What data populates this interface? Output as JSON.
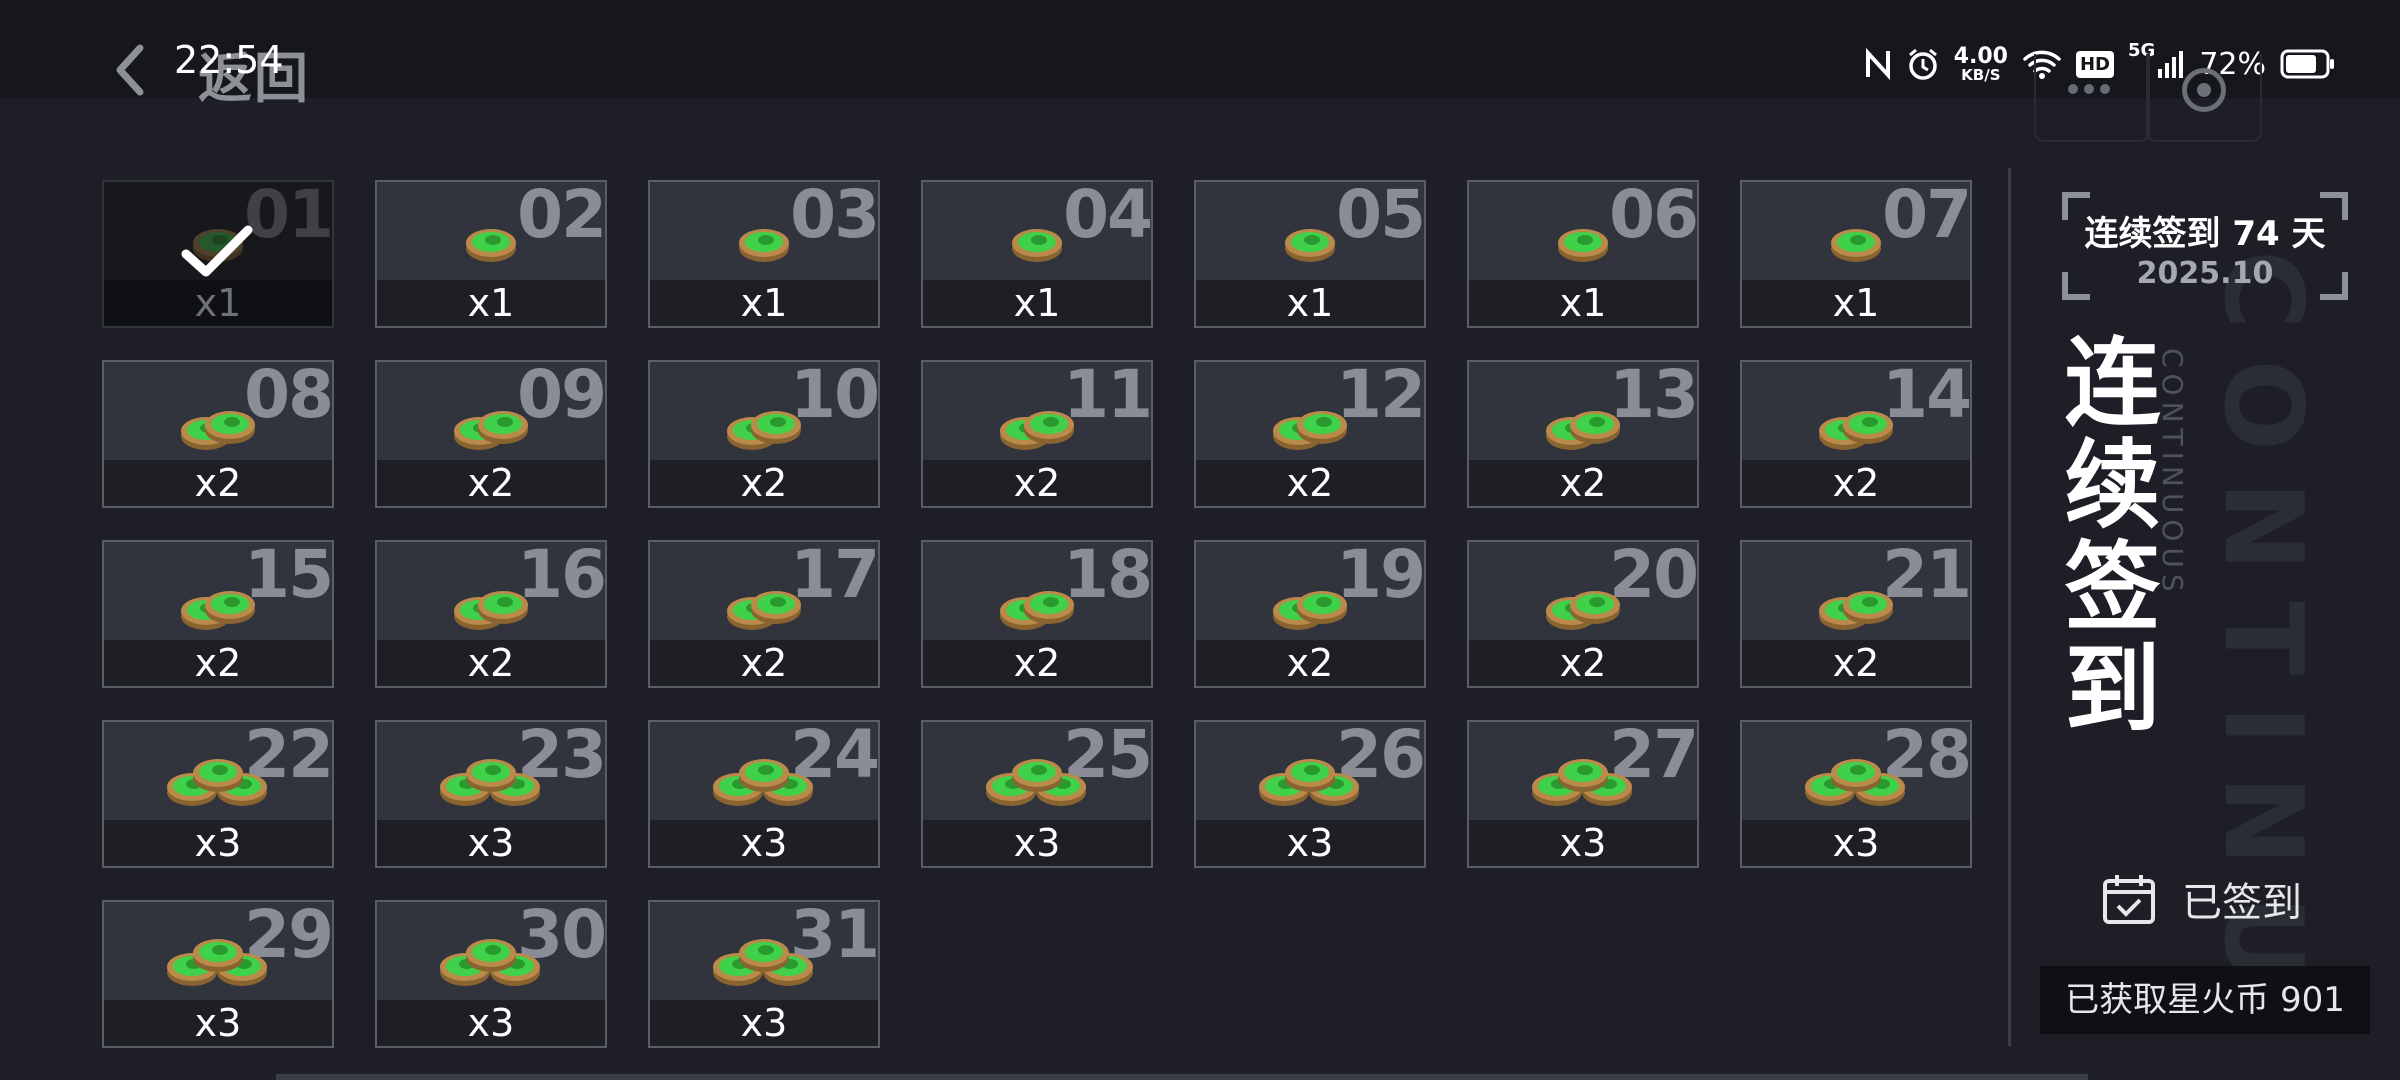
{
  "header": {
    "back_label": "返回",
    "time": "22:54",
    "net_speed_value": "4.00",
    "net_speed_unit": "KB/S",
    "hd_badge": "HD",
    "network_type": "5G",
    "battery_percent": "72%"
  },
  "days": [
    {
      "day": "01",
      "qty": "x1",
      "coins": 1,
      "claimed": true
    },
    {
      "day": "02",
      "qty": "x1",
      "coins": 1,
      "claimed": false
    },
    {
      "day": "03",
      "qty": "x1",
      "coins": 1,
      "claimed": false
    },
    {
      "day": "04",
      "qty": "x1",
      "coins": 1,
      "claimed": false
    },
    {
      "day": "05",
      "qty": "x1",
      "coins": 1,
      "claimed": false
    },
    {
      "day": "06",
      "qty": "x1",
      "coins": 1,
      "claimed": false
    },
    {
      "day": "07",
      "qty": "x1",
      "coins": 1,
      "claimed": false
    },
    {
      "day": "08",
      "qty": "x2",
      "coins": 2,
      "claimed": false
    },
    {
      "day": "09",
      "qty": "x2",
      "coins": 2,
      "claimed": false
    },
    {
      "day": "10",
      "qty": "x2",
      "coins": 2,
      "claimed": false
    },
    {
      "day": "11",
      "qty": "x2",
      "coins": 2,
      "claimed": false
    },
    {
      "day": "12",
      "qty": "x2",
      "coins": 2,
      "claimed": false
    },
    {
      "day": "13",
      "qty": "x2",
      "coins": 2,
      "claimed": false
    },
    {
      "day": "14",
      "qty": "x2",
      "coins": 2,
      "claimed": false
    },
    {
      "day": "15",
      "qty": "x2",
      "coins": 2,
      "claimed": false
    },
    {
      "day": "16",
      "qty": "x2",
      "coins": 2,
      "claimed": false
    },
    {
      "day": "17",
      "qty": "x2",
      "coins": 2,
      "claimed": false
    },
    {
      "day": "18",
      "qty": "x2",
      "coins": 2,
      "claimed": false
    },
    {
      "day": "19",
      "qty": "x2",
      "coins": 2,
      "claimed": false
    },
    {
      "day": "20",
      "qty": "x2",
      "coins": 2,
      "claimed": false
    },
    {
      "day": "21",
      "qty": "x2",
      "coins": 2,
      "claimed": false
    },
    {
      "day": "22",
      "qty": "x3",
      "coins": 3,
      "claimed": false
    },
    {
      "day": "23",
      "qty": "x3",
      "coins": 3,
      "claimed": false
    },
    {
      "day": "24",
      "qty": "x3",
      "coins": 3,
      "claimed": false
    },
    {
      "day": "25",
      "qty": "x3",
      "coins": 3,
      "claimed": false
    },
    {
      "day": "26",
      "qty": "x3",
      "coins": 3,
      "claimed": false
    },
    {
      "day": "27",
      "qty": "x3",
      "coins": 3,
      "claimed": false
    },
    {
      "day": "28",
      "qty": "x3",
      "coins": 3,
      "claimed": false
    },
    {
      "day": "29",
      "qty": "x3",
      "coins": 3,
      "claimed": false
    },
    {
      "day": "30",
      "qty": "x3",
      "coins": 3,
      "claimed": false
    },
    {
      "day": "31",
      "qty": "x3",
      "coins": 3,
      "claimed": false
    }
  ],
  "panel": {
    "streak_text": "连续签到 74 天",
    "month": "2025.10",
    "title": "连续签到",
    "subtitle": "CONTINUOUS",
    "bg_word": "CONTINU",
    "signed_label": "已签到",
    "earned_text": "已获取星火币 901"
  },
  "colors": {
    "background": "#1d1e26",
    "cell_bg": "#31333d",
    "coin_green": "#3fd14a",
    "coin_rim": "#b98a4a"
  }
}
